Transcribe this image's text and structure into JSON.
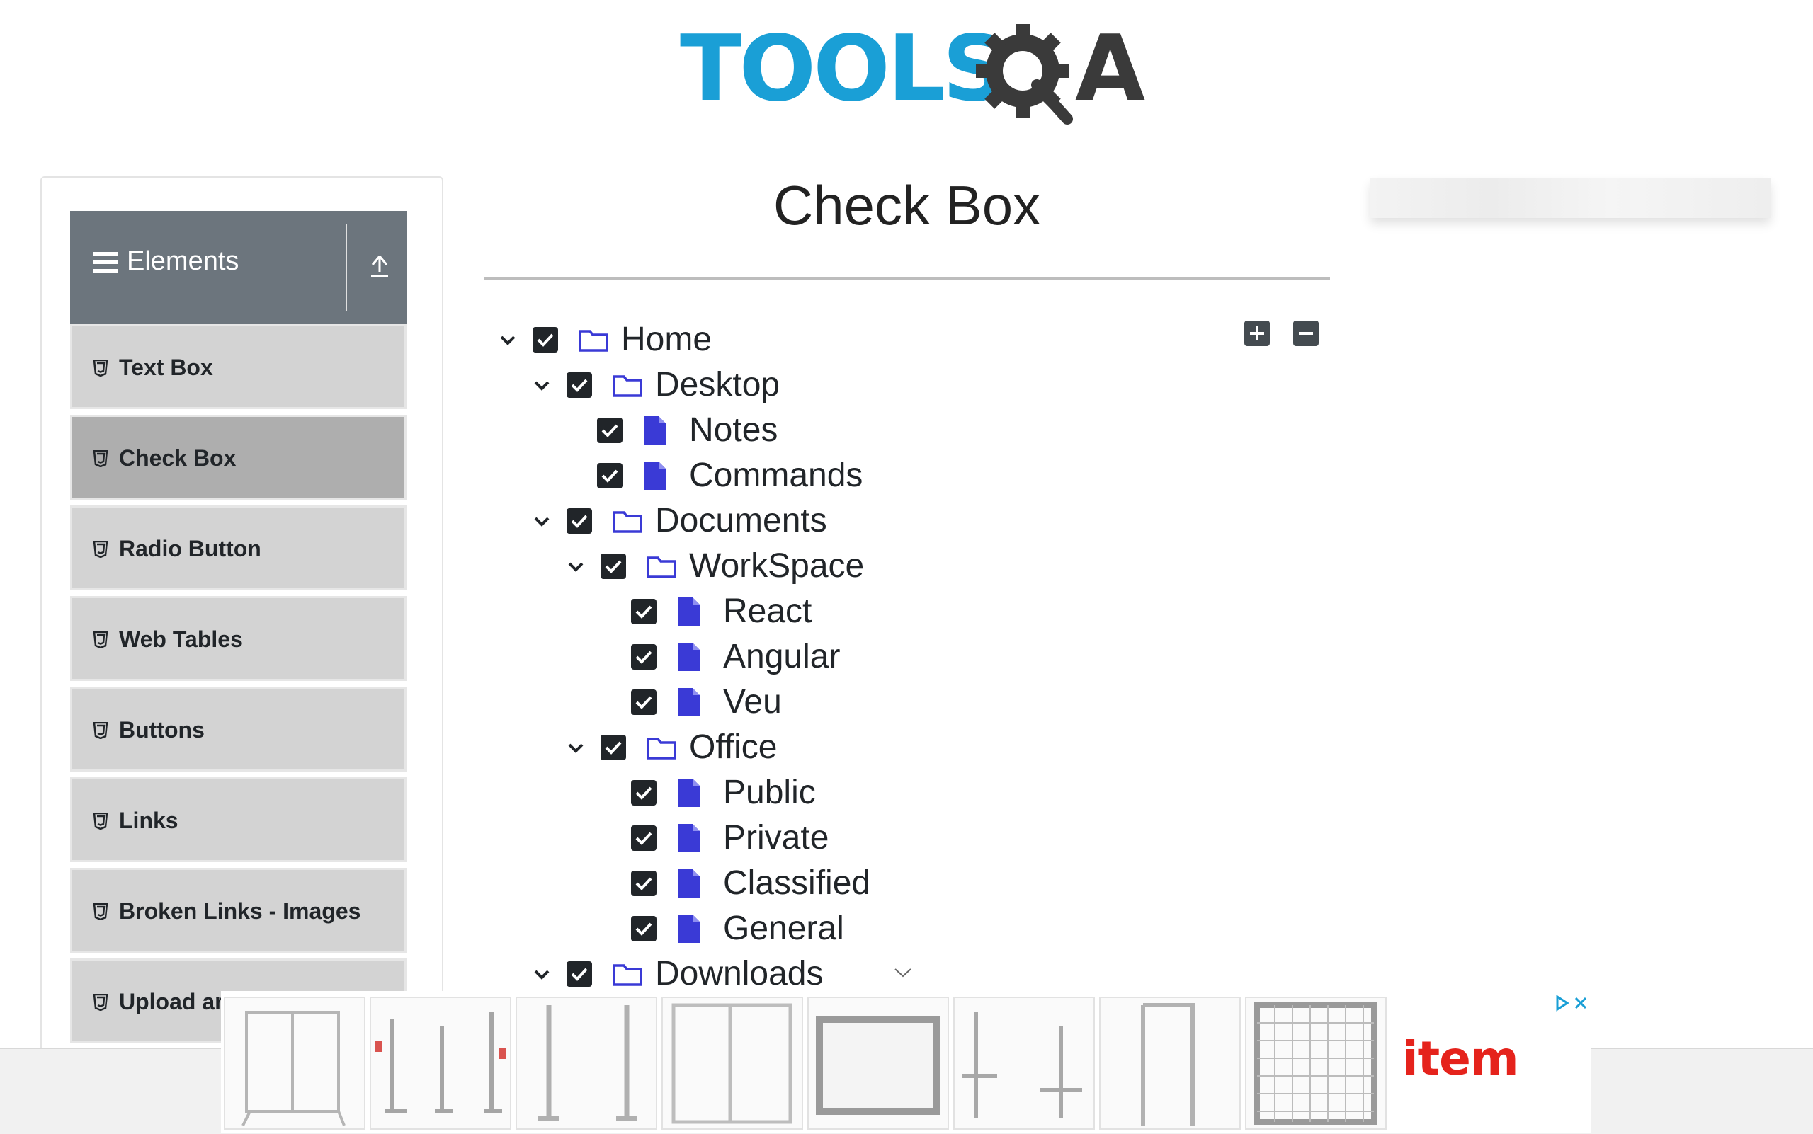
{
  "brand": {
    "logo_text": "TOOLS",
    "logo_suffix": "A",
    "logo_icon": "gear-q-icon",
    "color": "#1a9fd6"
  },
  "sidebar": {
    "group_title": "Elements",
    "items": [
      {
        "label": "Text Box",
        "icon": "html5-icon"
      },
      {
        "label": "Check Box",
        "icon": "html5-icon",
        "active": true
      },
      {
        "label": "Radio Button",
        "icon": "html5-icon"
      },
      {
        "label": "Web Tables",
        "icon": "html5-icon"
      },
      {
        "label": "Buttons",
        "icon": "html5-icon"
      },
      {
        "label": "Links",
        "icon": "html5-icon"
      },
      {
        "label": "Broken Links - Images",
        "icon": "html5-icon"
      },
      {
        "label": "Upload ar",
        "icon": "html5-icon"
      }
    ]
  },
  "main": {
    "title": "Check Box",
    "tree": [
      {
        "label": "Home",
        "type": "folder",
        "expanded": true,
        "checked": true
      },
      {
        "label": "Desktop",
        "type": "folder",
        "expanded": true,
        "checked": true
      },
      {
        "label": "Notes",
        "type": "file",
        "checked": true
      },
      {
        "label": "Commands",
        "type": "file",
        "checked": true
      },
      {
        "label": "Documents",
        "type": "folder",
        "expanded": true,
        "checked": true
      },
      {
        "label": "WorkSpace",
        "type": "folder",
        "expanded": true,
        "checked": true
      },
      {
        "label": "React",
        "type": "file",
        "checked": true
      },
      {
        "label": "Angular",
        "type": "file",
        "checked": true
      },
      {
        "label": "Veu",
        "type": "file",
        "checked": true
      },
      {
        "label": "Office",
        "type": "folder",
        "expanded": true,
        "checked": true
      },
      {
        "label": "Public",
        "type": "file",
        "checked": true
      },
      {
        "label": "Private",
        "type": "file",
        "checked": true
      },
      {
        "label": "Classified",
        "type": "file",
        "checked": true
      },
      {
        "label": "General",
        "type": "file",
        "checked": true
      },
      {
        "label": "Downloads",
        "type": "folder",
        "expanded": true,
        "checked": true
      }
    ]
  },
  "ad": {
    "brand": "item",
    "brand_color": "#e5231c"
  },
  "colors": {
    "accent_icon": "#3a3ad6",
    "sidebar_header": "#6c757d",
    "checkbox": "#212529"
  }
}
